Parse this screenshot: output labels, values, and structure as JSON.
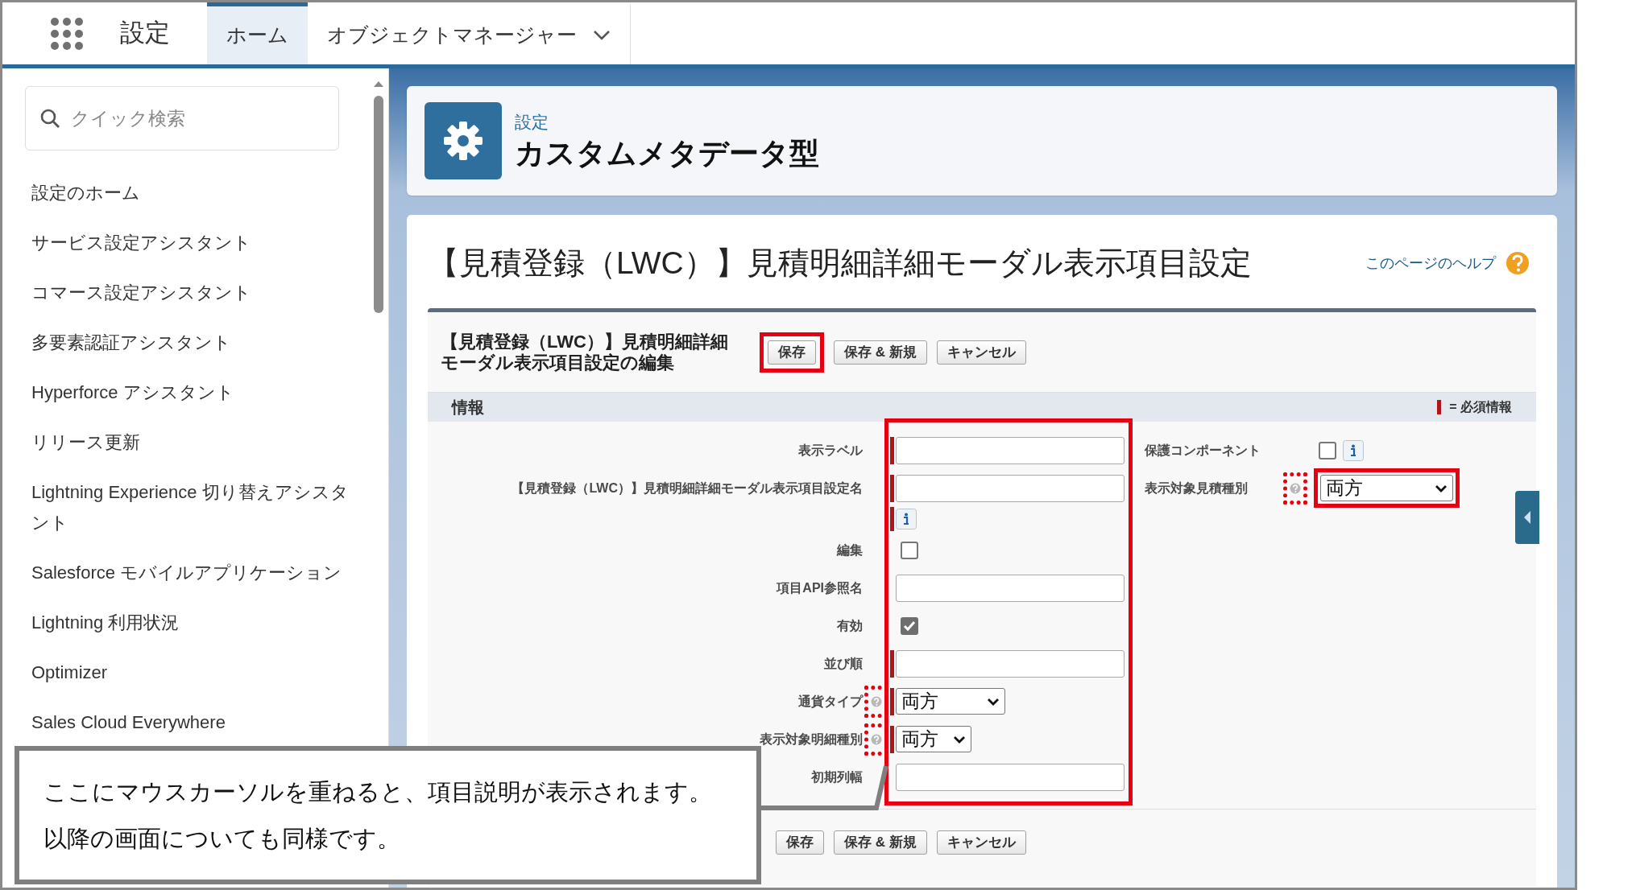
{
  "top_bar": {
    "app_title": "設定",
    "tabs": [
      {
        "label": "ホーム",
        "selected": true,
        "has_menu": false
      },
      {
        "label": "オブジェクトマネージャー",
        "selected": false,
        "has_menu": true
      }
    ]
  },
  "sidebar": {
    "search": {
      "placeholder": "クイック検索"
    },
    "items": [
      "設定のホーム",
      "サービス設定アシスタント",
      "コマース設定アシスタント",
      "多要素認証アシスタント",
      "Hyperforce アシスタント",
      "リリース更新",
      "Lightning Experience 切り替えアシスタント",
      "Salesforce モバイルアプリケーション",
      "Lightning 利用状況",
      "Optimizer",
      "Sales Cloud Everywhere"
    ]
  },
  "page_header": {
    "breadcrumb": "設定",
    "title": "カスタムメタデータ型"
  },
  "content": {
    "title": "【見積登録（LWC）】見積明細詳細モーダル表示項目設定",
    "help_link": "このページのヘルプ",
    "edit": {
      "title": "【見積登録（LWC）】見積明細詳細モーダル表示項目設定の編集",
      "buttons": [
        {
          "label": "保存",
          "highlighted": true
        },
        {
          "label": "保存 & 新規",
          "highlighted": false
        },
        {
          "label": "キャンセル",
          "highlighted": false
        }
      ],
      "section": "情報",
      "required_legend": "= 必須情報",
      "inputs_highlighted": true,
      "fields_left": [
        {
          "label": "表示ラベル",
          "kind": "text",
          "required": true,
          "info": false,
          "help": false
        },
        {
          "label": "【見積登録（LWC）】見積明細詳細モーダル表示項目設定名",
          "kind": "text",
          "required": true,
          "info": true,
          "help": false
        },
        {
          "label": "編集",
          "kind": "checkbox",
          "checked": false,
          "required": false,
          "info": false,
          "help": false
        },
        {
          "label": "項目API参照名",
          "kind": "text",
          "required": false,
          "info": false,
          "help": false
        },
        {
          "label": "有効",
          "kind": "checkbox",
          "checked": true,
          "required": false,
          "info": false,
          "help": false
        },
        {
          "label": "並び順",
          "kind": "text",
          "required": true,
          "info": false,
          "help": false
        },
        {
          "label": "通貨タイプ",
          "kind": "select",
          "value": "両方",
          "required": true,
          "info": false,
          "help": true,
          "help_marked": true
        },
        {
          "label": "表示対象明細種別",
          "kind": "select",
          "value": "両方",
          "required": true,
          "info": false,
          "help": true,
          "help_marked": true
        },
        {
          "label": "初期列幅",
          "kind": "text",
          "required": false,
          "info": false,
          "help": false
        }
      ],
      "fields_right": [
        {
          "label": "保護コンポーネント",
          "kind": "checkbox",
          "checked": false,
          "required": false,
          "info": true,
          "help": false,
          "highlighted": false
        },
        {
          "label": "表示対象見積種別",
          "kind": "select",
          "value": "両方",
          "required": false,
          "info": false,
          "help": true,
          "help_marked": true,
          "highlighted": true
        }
      ],
      "bottom_buttons": [
        {
          "label": "保存"
        },
        {
          "label": "保存 & 新規"
        },
        {
          "label": "キャンセル"
        }
      ]
    }
  },
  "callout": {
    "lines": [
      "ここにマウスカーソルを重ねると、項目説明が表示されます。",
      "以降の画面についても同様です。"
    ]
  }
}
